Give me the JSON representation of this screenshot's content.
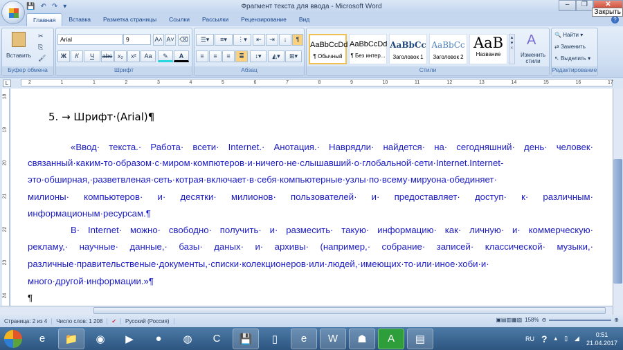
{
  "window": {
    "title": "Фрагмент текста для ввода - Microsoft Word",
    "close_tooltip": "Закрыть",
    "minimize": "–",
    "restore": "❐",
    "close": "✕"
  },
  "qat": {
    "save": "💾",
    "undo": "↶",
    "redo": "↷",
    "more": "▾"
  },
  "tabs": [
    "Главная",
    "Вставка",
    "Разметка страницы",
    "Ссылки",
    "Рассылки",
    "Рецензирование",
    "Вид"
  ],
  "ribbon": {
    "clipboard": {
      "label": "Буфер обмена",
      "paste": "Вставить"
    },
    "font": {
      "label": "Шрифт",
      "name": "Arial",
      "size": "9",
      "bold": "Ж",
      "italic": "К",
      "underline": "Ч",
      "strike": "abc",
      "sub": "x₂",
      "sup": "x²",
      "case": "Aa",
      "grow": "A˄",
      "shrink": "A˅",
      "color": "A"
    },
    "paragraph": {
      "label": "Абзац",
      "pilcrow": "¶"
    },
    "styles": {
      "label": "Стили",
      "items": [
        {
          "sample": "AaBbCcDd",
          "name": "¶ Обычный"
        },
        {
          "sample": "AaBbCcDd",
          "name": "¶ Без интер..."
        },
        {
          "sample": "AaBbCc",
          "name": "Заголовок 1"
        },
        {
          "sample": "AaBbCc",
          "name": "Заголовок 2"
        },
        {
          "sample": "AaB",
          "name": "Название"
        }
      ],
      "change": "Изменить стили"
    },
    "editing": {
      "label": "Редактирование",
      "find": "Найти",
      "replace": "Заменить",
      "select": "Выделить"
    }
  },
  "ruler": {
    "marks": [
      "2",
      "1",
      "1",
      "2",
      "3",
      "4",
      "5",
      "6",
      "7",
      "8",
      "9",
      "10",
      "11",
      "12",
      "13",
      "14",
      "15",
      "16",
      "17"
    ],
    "vmarks": [
      "18",
      "19",
      "20",
      "21",
      "22",
      "23",
      "24"
    ]
  },
  "document": {
    "heading": "5. → Шрифт·(Arial)¶",
    "lines": [
      "«Ввод· текста.· Работа· всети· Internet.· Анотация.· Наврядли· найдется· на· сегодняшний· день· человек·",
      "связанный·каким-то·образом·с·миром·компютеров·и·ничего·не·слышавший·о·глобальной·сети·Internet.Internet-",
      "это·обширная,·разветвленая·сеть·котрая·включает·в·себя·компьютерные·узлы·по·всему·мируона·обединяет·",
      "милионы· компьютеров· и· десятки· милионов· пользователей· и· предоставляет· доступ· к· различным·",
      "информационым·ресурсам.¶",
      "В· Internet· можно· свободно· получить· и· размесить· такую· информацию· как· личную· и· коммерческую·",
      "рекламу,· научные· данные,· базы· даных· и· архивы· (например,· собрание· записей· классической· музыки,·",
      "различные·правительственые·документы,·списки·колекционеров·или·людей,·имеющих·то·или·иное·хоби·и·",
      "много·другой·информации.»¶",
      "¶"
    ]
  },
  "status": {
    "page": "Страница: 2 из 4",
    "words": "Число слов: 1 208",
    "language": "Русский (Россия)",
    "zoom": "158%"
  },
  "tray": {
    "lang": "RU",
    "time": "0:51",
    "date": "21.04.2017"
  }
}
